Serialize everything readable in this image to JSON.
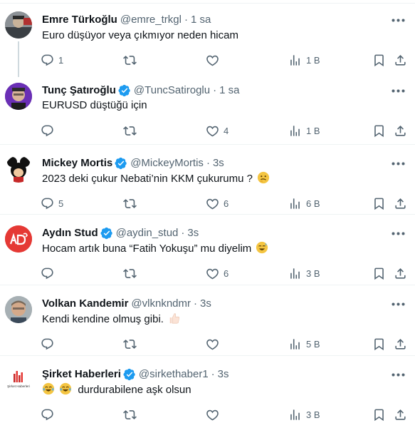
{
  "colors": {
    "text": "#0f1419",
    "muted": "#536471",
    "verified": "#1d9bf0",
    "border": "#eff3f4"
  },
  "tweets": [
    {
      "name": "Emre Türkoğlu",
      "handle": "@emre_trkgl",
      "dot": "·",
      "time": "1 sa",
      "verified": false,
      "text": "Euro düşüyor veya çıkmıyor neden hicam",
      "emoji": "",
      "replies": "1",
      "retweets": "",
      "likes": "",
      "views": "1 B"
    },
    {
      "name": "Tunç Şatıroğlu",
      "handle": "@TuncSatiroglu",
      "dot": "·",
      "time": "1 sa",
      "verified": true,
      "text": "EURUSD düştüğü için",
      "emoji": "",
      "replies": "",
      "retweets": "",
      "likes": "4",
      "views": "1 B"
    },
    {
      "name": "Mickey Mortis",
      "handle": "@MickeyMortis",
      "dot": "·",
      "time": "3s",
      "verified": true,
      "text": "2023 deki  çukur Nebati’nin KKM çukurumu ?",
      "emoji": "thinking-face-emoji",
      "replies": "5",
      "retweets": "",
      "likes": "6",
      "views": "6 B"
    },
    {
      "name": "Aydın Stud",
      "handle": "@aydin_stud",
      "dot": "·",
      "time": "3s",
      "verified": true,
      "text": "Hocam artık buna “Fatih Yokuşu” mu diyelim",
      "emoji": "sweat-smile-emoji",
      "replies": "",
      "retweets": "",
      "likes": "6",
      "views": "3 B"
    },
    {
      "name": "Volkan Kandemir",
      "handle": "@vlknkndmr",
      "dot": "·",
      "time": "3s",
      "verified": false,
      "text": "Kendi kendine olmuş gibi.",
      "emoji": "thumbs-up-emoji",
      "replies": "",
      "retweets": "",
      "likes": "",
      "views": "5 B"
    },
    {
      "name": "Şirket Haberleri",
      "handle": "@sirkethaber1",
      "dot": "·",
      "time": "3s",
      "verified": true,
      "text": "durdurabilene aşk olsun",
      "emoji": "joy-emoji",
      "replies": "",
      "retweets": "",
      "likes": "",
      "views": "3 B"
    }
  ],
  "avatar_text": {
    "sirket": "Şirket Haberleri"
  }
}
